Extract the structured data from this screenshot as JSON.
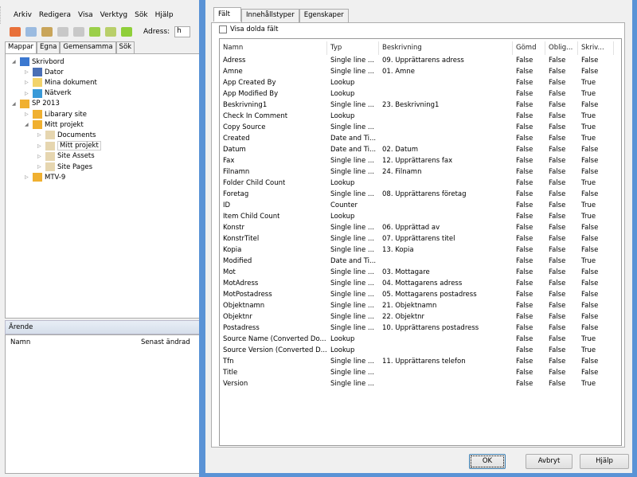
{
  "menu": [
    "Arkiv",
    "Redigera",
    "Visa",
    "Verktyg",
    "Sök",
    "Hjälp"
  ],
  "toolbar": {
    "address_label": "Adress:",
    "address_value": "h"
  },
  "left_tabs": [
    "Mappar",
    "Egna",
    "Gemensamma",
    "Sök"
  ],
  "tree": [
    {
      "label": "Skrivbord",
      "level": 0,
      "icon": "desktop-icon",
      "expanded": true
    },
    {
      "label": "Dator",
      "level": 1,
      "icon": "computer-icon"
    },
    {
      "label": "Mina dokument",
      "level": 1,
      "icon": "documents-folder-icon"
    },
    {
      "label": "Nätverk",
      "level": 1,
      "icon": "network-icon"
    },
    {
      "label": "SP 2013",
      "level": 0,
      "icon": "sharepoint-site-icon",
      "expanded": true
    },
    {
      "label": "Libarary site",
      "level": 1,
      "icon": "sharepoint-site-icon"
    },
    {
      "label": "Mitt projekt",
      "level": 1,
      "icon": "sharepoint-site-icon",
      "expanded": true
    },
    {
      "label": "Documents",
      "level": 2,
      "icon": "library-icon"
    },
    {
      "label": "Mitt projekt",
      "level": 2,
      "icon": "library-icon",
      "selected": true
    },
    {
      "label": "Site Assets",
      "level": 2,
      "icon": "library-icon"
    },
    {
      "label": "Site Pages",
      "level": 2,
      "icon": "library-icon"
    },
    {
      "label": "MTV-9",
      "level": 1,
      "icon": "sharepoint-site-icon"
    }
  ],
  "lower_pane": {
    "title": "Ärende",
    "columns": [
      "Namn",
      "Senast ändrad"
    ]
  },
  "dialog": {
    "tabs": [
      "Fält",
      "Innehållstyper",
      "Egenskaper"
    ],
    "show_hidden_label": "Visa dolda fält",
    "show_hidden_checked": false,
    "columns": [
      "Namn",
      "Typ",
      "Beskrivning",
      "Gömd",
      "Oblig...",
      "Skriv..."
    ],
    "rows": [
      [
        "Adress",
        "Single line ...",
        "09. Upprättarens adress",
        "False",
        "False",
        "False"
      ],
      [
        "Amne",
        "Single line ...",
        "01. Ämne",
        "False",
        "False",
        "False"
      ],
      [
        "App Created By",
        "Lookup",
        "",
        "False",
        "False",
        "True"
      ],
      [
        "App Modified By",
        "Lookup",
        "",
        "False",
        "False",
        "True"
      ],
      [
        "Beskrivning1",
        "Single line ...",
        "23. Beskrivning1",
        "False",
        "False",
        "False"
      ],
      [
        "Check In Comment",
        "Lookup",
        "",
        "False",
        "False",
        "True"
      ],
      [
        "Copy Source",
        "Single line ...",
        "",
        "False",
        "False",
        "True"
      ],
      [
        "Created",
        "Date and Ti...",
        "",
        "False",
        "False",
        "True"
      ],
      [
        "Datum",
        "Date and Ti...",
        "02. Datum",
        "False",
        "False",
        "False"
      ],
      [
        "Fax",
        "Single line ...",
        "12. Upprättarens fax",
        "False",
        "False",
        "False"
      ],
      [
        "Filnamn",
        "Single line ...",
        "24. Filnamn",
        "False",
        "False",
        "False"
      ],
      [
        "Folder Child Count",
        "Lookup",
        "",
        "False",
        "False",
        "True"
      ],
      [
        "Foretag",
        "Single line ...",
        "08. Upprättarens företag",
        "False",
        "False",
        "False"
      ],
      [
        "ID",
        "Counter",
        "",
        "False",
        "False",
        "True"
      ],
      [
        "Item Child Count",
        "Lookup",
        "",
        "False",
        "False",
        "True"
      ],
      [
        "Konstr",
        "Single line ...",
        "06. Upprättad av",
        "False",
        "False",
        "False"
      ],
      [
        "KonstrTitel",
        "Single line ...",
        "07. Upprättarens titel",
        "False",
        "False",
        "False"
      ],
      [
        "Kopia",
        "Single line ...",
        "13. Kopia",
        "False",
        "False",
        "False"
      ],
      [
        "Modified",
        "Date and Ti...",
        "",
        "False",
        "False",
        "True"
      ],
      [
        "Mot",
        "Single line ...",
        "03. Mottagare",
        "False",
        "False",
        "False"
      ],
      [
        "MotAdress",
        "Single line ...",
        "04. Mottagarens adress",
        "False",
        "False",
        "False"
      ],
      [
        "MotPostadress",
        "Single line ...",
        "05. Mottagarens postadress",
        "False",
        "False",
        "False"
      ],
      [
        "Objektnamn",
        "Single line ...",
        "21. Objektnamn",
        "False",
        "False",
        "False"
      ],
      [
        "Objektnr",
        "Single line ...",
        "22. Objektnr",
        "False",
        "False",
        "False"
      ],
      [
        "Postadress",
        "Single line ...",
        "10. Upprättarens postadress",
        "False",
        "False",
        "False"
      ],
      [
        "Source Name (Converted Do...",
        "Lookup",
        "",
        "False",
        "False",
        "True"
      ],
      [
        "Source Version (Converted D...",
        "Lookup",
        "",
        "False",
        "False",
        "True"
      ],
      [
        "Tfn",
        "Single line ...",
        "11. Upprättarens telefon",
        "False",
        "False",
        "False"
      ],
      [
        "Title",
        "Single line ...",
        "",
        "False",
        "False",
        "False"
      ],
      [
        "Version",
        "Single line ...",
        "",
        "False",
        "False",
        "True"
      ]
    ],
    "buttons": {
      "ok": "OK",
      "cancel": "Avbryt",
      "help": "Hjälp"
    }
  },
  "colors": {
    "dialog_border": "#5a93d6",
    "selection": "#e5f0fb"
  }
}
